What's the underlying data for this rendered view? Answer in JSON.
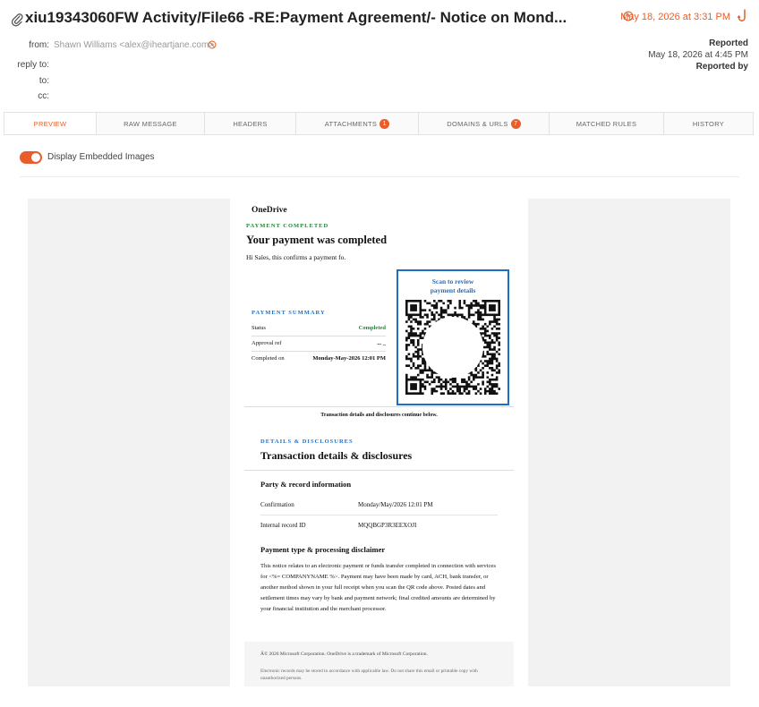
{
  "header": {
    "title": "xiu19343060FW Activity/File66 -RE:Payment Agreement/- Notice on Mond...",
    "received_date": "May 18, 2026 at 3:31 PM",
    "from_label": "from:",
    "from_value": "Shawn Williams <alex@iheartjane.com>",
    "reply_to_label": "reply to:",
    "to_label": "to:",
    "cc_label": "cc:",
    "reported_label": "Reported",
    "reported_date": "May 18, 2026 at 4:45 PM",
    "reported_by_label": "Reported by"
  },
  "tabs": [
    {
      "label": "PREVIEW",
      "active": true
    },
    {
      "label": "RAW MESSAGE"
    },
    {
      "label": "HEADERS"
    },
    {
      "label": "ATTACHMENTS",
      "badge": "1"
    },
    {
      "label": "DOMAINS & URLS",
      "badge": "7"
    },
    {
      "label": "MATCHED RULES"
    },
    {
      "label": "HISTORY"
    }
  ],
  "toggle": {
    "label": "Display Embedded Images",
    "on": true
  },
  "email": {
    "brand": "OneDrive",
    "eyebrow": "PAYMENT COMPLETED",
    "headline": "Your payment was completed",
    "intro": "Hi Sales, this confirms a payment fo.",
    "summary_title": "PAYMENT SUMMARY",
    "summary": [
      {
        "k": "Status",
        "v": "Completed"
      },
      {
        "k": "Approval ref",
        "v": "... _"
      },
      {
        "k": "Completed on",
        "v": "Monday-May-2026 12:01 PM"
      }
    ],
    "qr_caption_1": "Scan to review",
    "qr_caption_2": "payment details",
    "continue_note": "Transaction details and disclosures continue below.",
    "details_eyebrow": "DETAILS & DISCLOSURES",
    "details_title": "Transaction details & disclosures",
    "party_title": "Party & record information",
    "details": [
      {
        "k": "Confirmation",
        "v": "Monday/May/2026 12:01 PM"
      },
      {
        "k": "Internal record ID",
        "v": "MQQBGP3R3EEXOJI"
      }
    ],
    "disclaimer_title": "Payment type & processing disclaimer",
    "disclaimer": "This notice relates to an electronic payment or funds transfer completed in connection with services for <%= COMPANYNAME %>. Payment may have been made by card, ACH, bank transfer, or another method shown in your full receipt when you scan the QR code above. Posted dates and settlement times may vary by bank and payment network; final credited amounts are determined by your financial institution and the merchant processor.",
    "footer_1": "Â© 2026 Microsoft Corporation. OneDrive is a trademark of Microsoft Corporation.",
    "footer_2": "Electronic records may be stored in accordance with applicable law. Do not share this email or printable copy with unauthorized persons."
  },
  "colors": {
    "accent": "#e85d2a",
    "link_blue": "#1e6fc4",
    "success_green": "#1e8a2e"
  },
  "icons": [
    "paperclip-icon",
    "clock-icon",
    "hook-icon",
    "ban-icon",
    "qr-code"
  ]
}
